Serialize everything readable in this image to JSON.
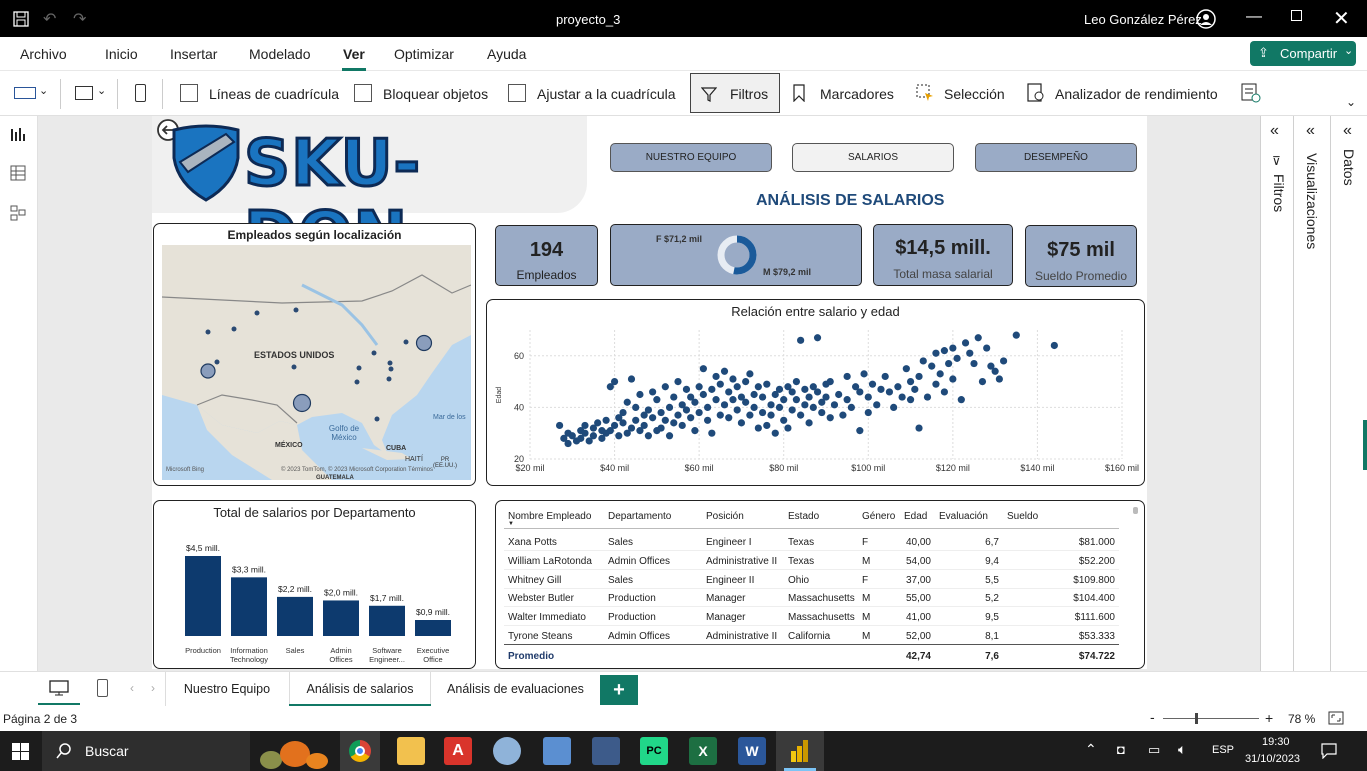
{
  "window": {
    "title": "proyecto_3",
    "user": "Leo González Pérez"
  },
  "menu": [
    "Archivo",
    "Inicio",
    "Insertar",
    "Modelado",
    "Ver",
    "Optimizar",
    "Ayuda"
  ],
  "active_menu": "Ver",
  "share_label": "Compartir",
  "ribbon": {
    "gridlines": "Líneas de cuadrícula",
    "lock": "Bloquear objetos",
    "snap": "Ajustar a la cuadrícula",
    "filters": "Filtros",
    "bookmarks": "Marcadores",
    "selection": "Selección",
    "perf": "Analizador de rendimiento"
  },
  "panes": {
    "filters": "Filtros",
    "visualizations": "Visualizaciones",
    "data": "Datos"
  },
  "report": {
    "logo_text": "SKU-DON",
    "nav": [
      "NUESTRO EQUIPO",
      "SALARIOS",
      "DESEMPEÑO"
    ],
    "page_title": "ANÁLISIS DE SALARIOS",
    "kpi": {
      "employees_value": "194",
      "employees_label": "Empleados",
      "female": "F $71,2 mil",
      "male": "M $79,2 mil",
      "female_share": 0.47,
      "total_value": "$14,5 mill.",
      "total_label": "Total masa salarial",
      "avg_value": "$75 mil",
      "avg_label": "Sueldo Promedio"
    },
    "map": {
      "title": "Empleados según localización",
      "labels": {
        "country": "ESTADOS UNIDOS",
        "gulf": "Golfo de\nMéxico",
        "mexico": "MÉXICO",
        "cuba": "CUBA",
        "haiti": "HAITÍ",
        "pr": "PR\n(EE.UU.)",
        "guatemala": "GUATEMALA",
        "sea": "Mar de los",
        "bing": "Microsoft Bing",
        "copyright": "© 2023 TomTom, © 2023 Microsoft Corporation  Términos"
      }
    },
    "scatter_title": "Relación entre salario y edad",
    "bar_title": "Total de salarios por Departamento",
    "table": {
      "headers": [
        "Nombre Empleado",
        "Departamento",
        "Posición",
        "Estado",
        "Género",
        "Edad",
        "Evaluación",
        "Sueldo"
      ],
      "rows": [
        [
          "Xana Potts",
          "Sales",
          "Engineer I",
          "Texas",
          "F",
          "40,00",
          "6,7",
          "$81.000"
        ],
        [
          "William LaRotonda",
          "Admin Offices",
          "Administrative II",
          "Texas",
          "M",
          "54,00",
          "9,4",
          "$52.200"
        ],
        [
          "Whitney Gill",
          "Sales",
          "Engineer II",
          "Ohio",
          "F",
          "37,00",
          "5,5",
          "$109.800"
        ],
        [
          "Webster Butler",
          "Production",
          "Manager",
          "Massachusetts",
          "M",
          "55,00",
          "5,2",
          "$104.400"
        ],
        [
          "Walter Immediato",
          "Production",
          "Manager",
          "Massachusetts",
          "M",
          "41,00",
          "9,5",
          "$111.600"
        ],
        [
          "Tyrone Steans",
          "Admin Offices",
          "Administrative II",
          "California",
          "M",
          "52,00",
          "8,1",
          "$53.333"
        ]
      ],
      "total": [
        "Promedio",
        "42,74",
        "7,6",
        "$74.722"
      ]
    }
  },
  "tabs": [
    "Nuestro Equipo",
    "Análisis de salarios",
    "Análisis de evaluaciones"
  ],
  "active_tab": "Análisis de salarios",
  "status": {
    "page": "Página 2 de 3",
    "zoom": "78 %"
  },
  "taskbar": {
    "search": "Buscar",
    "lang": "ESP",
    "time": "19:30",
    "date": "31/10/2023"
  },
  "colors": {
    "accent": "#117865",
    "navy": "#0d3a6e",
    "card": "#9aabc6",
    "point": "#1f4a7a"
  },
  "chart_data": [
    {
      "type": "scatter",
      "title": "Relación entre salario y edad",
      "xlabel": "",
      "ylabel": "Edad",
      "xlim": [
        20,
        160
      ],
      "ylim": [
        20,
        70
      ],
      "x_ticks": [
        "$20 mil",
        "$40 mil",
        "$60 mil",
        "$80 mil",
        "$100 mil",
        "$120 mil",
        "$140 mil",
        "$160 mil"
      ],
      "y_ticks": [
        "20",
        "40",
        "60"
      ],
      "points": [
        [
          27,
          33
        ],
        [
          28,
          28
        ],
        [
          29,
          30
        ],
        [
          29,
          26
        ],
        [
          30,
          29
        ],
        [
          31,
          27
        ],
        [
          32,
          31
        ],
        [
          32,
          28
        ],
        [
          33,
          33
        ],
        [
          33,
          30
        ],
        [
          34,
          27
        ],
        [
          35,
          29
        ],
        [
          35,
          32
        ],
        [
          36,
          34
        ],
        [
          37,
          31
        ],
        [
          37,
          28
        ],
        [
          38,
          30
        ],
        [
          38,
          35
        ],
        [
          39,
          48
        ],
        [
          39,
          31
        ],
        [
          40,
          33
        ],
        [
          40,
          50
        ],
        [
          41,
          29
        ],
        [
          41,
          36
        ],
        [
          42,
          34
        ],
        [
          42,
          38
        ],
        [
          43,
          30
        ],
        [
          43,
          42
        ],
        [
          44,
          32
        ],
        [
          44,
          51
        ],
        [
          45,
          35
        ],
        [
          45,
          40
        ],
        [
          46,
          31
        ],
        [
          46,
          45
        ],
        [
          47,
          33
        ],
        [
          47,
          37
        ],
        [
          48,
          29
        ],
        [
          48,
          39
        ],
        [
          49,
          36
        ],
        [
          49,
          46
        ],
        [
          50,
          31
        ],
        [
          50,
          43
        ],
        [
          51,
          38
        ],
        [
          51,
          32
        ],
        [
          52,
          48
        ],
        [
          52,
          35
        ],
        [
          53,
          40
        ],
        [
          53,
          29
        ],
        [
          54,
          44
        ],
        [
          54,
          34
        ],
        [
          55,
          37
        ],
        [
          55,
          50
        ],
        [
          56,
          41
        ],
        [
          56,
          33
        ],
        [
          57,
          47
        ],
        [
          57,
          39
        ],
        [
          58,
          36
        ],
        [
          58,
          44
        ],
        [
          59,
          42
        ],
        [
          59,
          31
        ],
        [
          60,
          48
        ],
        [
          60,
          38
        ],
        [
          61,
          45
        ],
        [
          61,
          55
        ],
        [
          62,
          40
        ],
        [
          62,
          35
        ],
        [
          63,
          47
        ],
        [
          63,
          30
        ],
        [
          64,
          52
        ],
        [
          64,
          43
        ],
        [
          65,
          37
        ],
        [
          65,
          49
        ],
        [
          66,
          41
        ],
        [
          66,
          54
        ],
        [
          67,
          46
        ],
        [
          67,
          36
        ],
        [
          68,
          43
        ],
        [
          68,
          51
        ],
        [
          69,
          39
        ],
        [
          69,
          48
        ],
        [
          70,
          44
        ],
        [
          70,
          34
        ],
        [
          71,
          50
        ],
        [
          71,
          42
        ],
        [
          72,
          37
        ],
        [
          72,
          53
        ],
        [
          73,
          45
        ],
        [
          73,
          40
        ],
        [
          74,
          32
        ],
        [
          74,
          48
        ],
        [
          75,
          44
        ],
        [
          75,
          38
        ],
        [
          76,
          33
        ],
        [
          76,
          49
        ],
        [
          77,
          41
        ],
        [
          77,
          37
        ],
        [
          78,
          45
        ],
        [
          78,
          30
        ],
        [
          79,
          47
        ],
        [
          79,
          40
        ],
        [
          80,
          43
        ],
        [
          80,
          35
        ],
        [
          81,
          48
        ],
        [
          81,
          32
        ],
        [
          82,
          39
        ],
        [
          82,
          46
        ],
        [
          83,
          43
        ],
        [
          83,
          50
        ],
        [
          84,
          37
        ],
        [
          84,
          66
        ],
        [
          85,
          47
        ],
        [
          85,
          41
        ],
        [
          86,
          44
        ],
        [
          86,
          34
        ],
        [
          87,
          40
        ],
        [
          87,
          48
        ],
        [
          88,
          46
        ],
        [
          88,
          67
        ],
        [
          89,
          42
        ],
        [
          89,
          38
        ],
        [
          90,
          49
        ],
        [
          90,
          44
        ],
        [
          91,
          36
        ],
        [
          91,
          50
        ],
        [
          92,
          41
        ],
        [
          93,
          45
        ],
        [
          94,
          37
        ],
        [
          95,
          52
        ],
        [
          95,
          43
        ],
        [
          96,
          40
        ],
        [
          97,
          48
        ],
        [
          98,
          31
        ],
        [
          98,
          46
        ],
        [
          99,
          53
        ],
        [
          100,
          44
        ],
        [
          100,
          38
        ],
        [
          101,
          49
        ],
        [
          102,
          41
        ],
        [
          103,
          47
        ],
        [
          104,
          52
        ],
        [
          105,
          46
        ],
        [
          106,
          40
        ],
        [
          107,
          48
        ],
        [
          108,
          44
        ],
        [
          109,
          55
        ],
        [
          110,
          50
        ],
        [
          110,
          43
        ],
        [
          111,
          47
        ],
        [
          112,
          32
        ],
        [
          112,
          52
        ],
        [
          113,
          58
        ],
        [
          114,
          44
        ],
        [
          115,
          56
        ],
        [
          116,
          49
        ],
        [
          116,
          61
        ],
        [
          117,
          53
        ],
        [
          118,
          46
        ],
        [
          118,
          62
        ],
        [
          119,
          57
        ],
        [
          120,
          51
        ],
        [
          120,
          63
        ],
        [
          121,
          59
        ],
        [
          122,
          43
        ],
        [
          123,
          65
        ],
        [
          124,
          61
        ],
        [
          125,
          57
        ],
        [
          126,
          67
        ],
        [
          127,
          50
        ],
        [
          128,
          63
        ],
        [
          129,
          56
        ],
        [
          130,
          54
        ],
        [
          131,
          51
        ],
        [
          132,
          58
        ],
        [
          135,
          68
        ],
        [
          144,
          64
        ]
      ]
    },
    {
      "type": "bar",
      "title": "Total de salarios por Departamento",
      "categories": [
        "Production",
        "Information Technology",
        "Sales",
        "Admin Offices",
        "Software Engineer...",
        "Executive Office"
      ],
      "values": [
        4.5,
        3.3,
        2.2,
        2.0,
        1.7,
        0.9
      ],
      "labels": [
        "$4,5 mill.",
        "$3,3 mill.",
        "$2,2 mill.",
        "$2,0 mill.",
        "$1,7 mill.",
        "$0,9 mill."
      ]
    }
  ]
}
